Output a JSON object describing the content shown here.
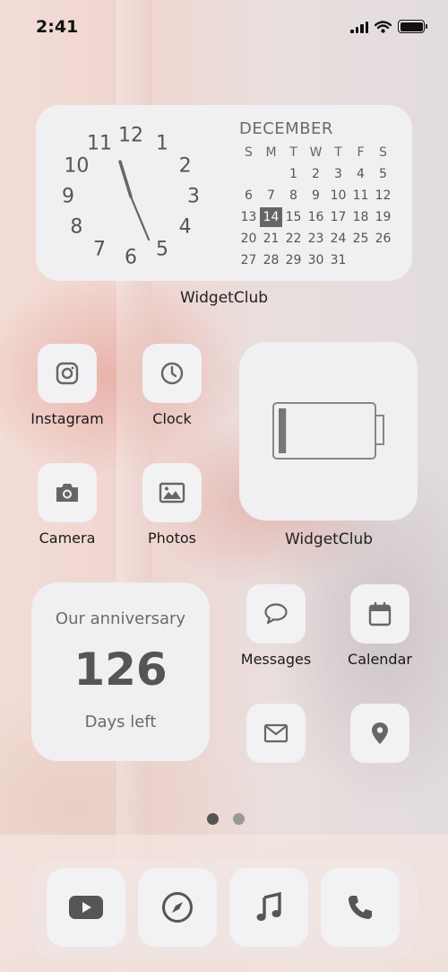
{
  "status": {
    "time": "2:41"
  },
  "clock_widget": {
    "numbers": [
      "12",
      "1",
      "2",
      "3",
      "4",
      "5",
      "6",
      "7",
      "8",
      "9",
      "10",
      "11"
    ],
    "caption": "WidgetClub"
  },
  "calendar": {
    "month": "DECEMBER",
    "weekdays": [
      "S",
      "M",
      "T",
      "W",
      "T",
      "F",
      "S"
    ],
    "weeks": [
      [
        "",
        "",
        "1",
        "2",
        "3",
        "4",
        "5"
      ],
      [
        "6",
        "7",
        "8",
        "9",
        "10",
        "11",
        "12"
      ],
      [
        "13",
        "14",
        "15",
        "16",
        "17",
        "18",
        "19"
      ],
      [
        "20",
        "21",
        "22",
        "23",
        "24",
        "25",
        "26"
      ],
      [
        "27",
        "28",
        "29",
        "30",
        "31",
        "",
        ""
      ]
    ],
    "today": "14"
  },
  "apps": {
    "instagram": {
      "label": "Instagram",
      "icon": "instagram-icon"
    },
    "clock": {
      "label": "Clock",
      "icon": "clock-icon"
    },
    "camera": {
      "label": "Camera",
      "icon": "camera-icon"
    },
    "photos": {
      "label": "Photos",
      "icon": "photos-icon"
    },
    "messages": {
      "label": "Messages",
      "icon": "message-bubble-icon"
    },
    "calendar": {
      "label": "Calendar",
      "icon": "calendar-icon"
    },
    "mail": {
      "icon": "envelope-icon"
    },
    "maps": {
      "icon": "location-pin-icon"
    }
  },
  "battery_widget": {
    "caption": "WidgetClub",
    "level": 0.08
  },
  "anniversary": {
    "title": "Our anniversary",
    "count": "126",
    "subtitle": "Days left"
  },
  "pages": {
    "count": 2,
    "current": 1
  },
  "dock": [
    {
      "icon": "youtube-icon"
    },
    {
      "icon": "compass-icon"
    },
    {
      "icon": "music-note-icon"
    },
    {
      "icon": "phone-icon"
    }
  ],
  "colors": {
    "widget_bg": "#f0eff2",
    "icon_gray": "#666666",
    "accent_dark": "#555555"
  }
}
